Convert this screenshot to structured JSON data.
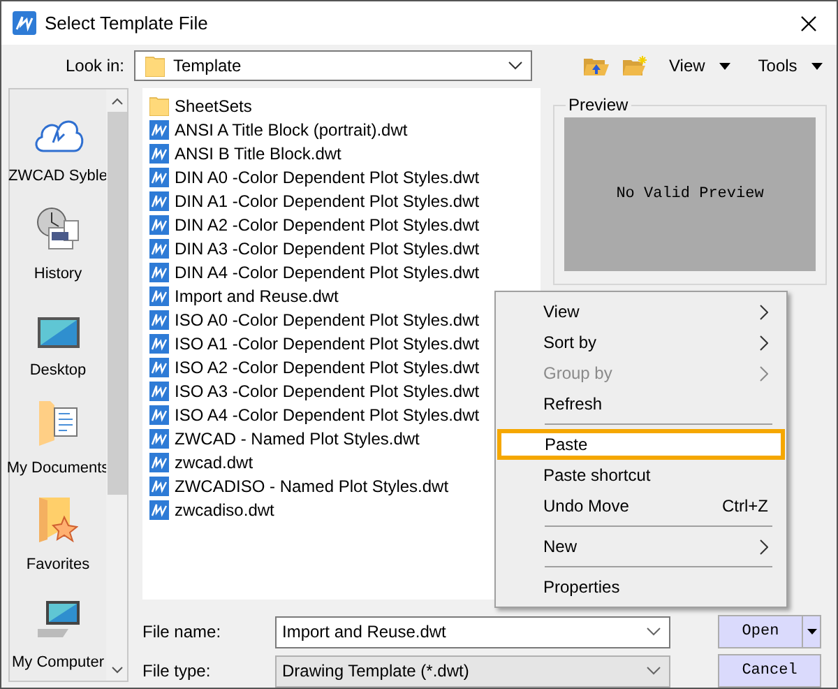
{
  "window": {
    "title": "Select Template File"
  },
  "look_in": {
    "label": "Look in:",
    "value": "Template"
  },
  "toolbar": {
    "view": "View",
    "tools": "Tools"
  },
  "sidebar": {
    "items": [
      {
        "label": "ZWCAD Syble"
      },
      {
        "label": "History"
      },
      {
        "label": "Desktop"
      },
      {
        "label": "My Documents"
      },
      {
        "label": "Favorites"
      },
      {
        "label": "My Computer"
      }
    ]
  },
  "files": [
    {
      "name": "SheetSets",
      "kind": "folder"
    },
    {
      "name": "ANSI A Title Block (portrait).dwt",
      "kind": "template"
    },
    {
      "name": "ANSI B Title Block.dwt",
      "kind": "template"
    },
    {
      "name": "DIN A0 -Color Dependent Plot Styles.dwt",
      "kind": "template"
    },
    {
      "name": "DIN A1 -Color Dependent Plot Styles.dwt",
      "kind": "template"
    },
    {
      "name": "DIN A2 -Color Dependent Plot Styles.dwt",
      "kind": "template"
    },
    {
      "name": "DIN A3 -Color Dependent Plot Styles.dwt",
      "kind": "template"
    },
    {
      "name": "DIN A4 -Color Dependent Plot Styles.dwt",
      "kind": "template"
    },
    {
      "name": "Import and Reuse.dwt",
      "kind": "template"
    },
    {
      "name": "ISO A0 -Color Dependent Plot Styles.dwt",
      "kind": "template"
    },
    {
      "name": "ISO A1 -Color Dependent Plot Styles.dwt",
      "kind": "template"
    },
    {
      "name": "ISO A2 -Color Dependent Plot Styles.dwt",
      "kind": "template"
    },
    {
      "name": "ISO A3 -Color Dependent Plot Styles.dwt",
      "kind": "template"
    },
    {
      "name": "ISO A4 -Color Dependent Plot Styles.dwt",
      "kind": "template"
    },
    {
      "name": "ZWCAD - Named Plot Styles.dwt",
      "kind": "template"
    },
    {
      "name": "zwcad.dwt",
      "kind": "template"
    },
    {
      "name": "ZWCADISO - Named Plot Styles.dwt",
      "kind": "template"
    },
    {
      "name": "zwcadiso.dwt",
      "kind": "template"
    }
  ],
  "preview": {
    "label": "Preview",
    "message": "No Valid Preview"
  },
  "file_name": {
    "label": "File name:",
    "value": "Import and Reuse.dwt"
  },
  "file_type": {
    "label": "File type:",
    "value": "Drawing Template (*.dwt)"
  },
  "buttons": {
    "open": "Open",
    "cancel": "Cancel"
  },
  "context_menu": [
    {
      "kind": "item",
      "label": "View",
      "submenu": true,
      "disabled": false,
      "highlighted": false
    },
    {
      "kind": "item",
      "label": "Sort by",
      "submenu": true,
      "disabled": false,
      "highlighted": false
    },
    {
      "kind": "item",
      "label": "Group by",
      "submenu": true,
      "disabled": true,
      "highlighted": false
    },
    {
      "kind": "item",
      "label": "Refresh",
      "submenu": false,
      "disabled": false,
      "highlighted": false
    },
    {
      "kind": "separator"
    },
    {
      "kind": "item",
      "label": "Paste",
      "submenu": false,
      "disabled": false,
      "highlighted": true
    },
    {
      "kind": "item",
      "label": "Paste shortcut",
      "submenu": false,
      "disabled": false,
      "highlighted": false
    },
    {
      "kind": "item",
      "label": "Undo Move",
      "shortcut": "Ctrl+Z",
      "submenu": false,
      "disabled": false,
      "highlighted": false
    },
    {
      "kind": "separator"
    },
    {
      "kind": "item",
      "label": "New",
      "submenu": true,
      "disabled": false,
      "highlighted": false
    },
    {
      "kind": "separator"
    },
    {
      "kind": "item",
      "label": "Properties",
      "submenu": false,
      "disabled": false,
      "highlighted": false
    }
  ]
}
